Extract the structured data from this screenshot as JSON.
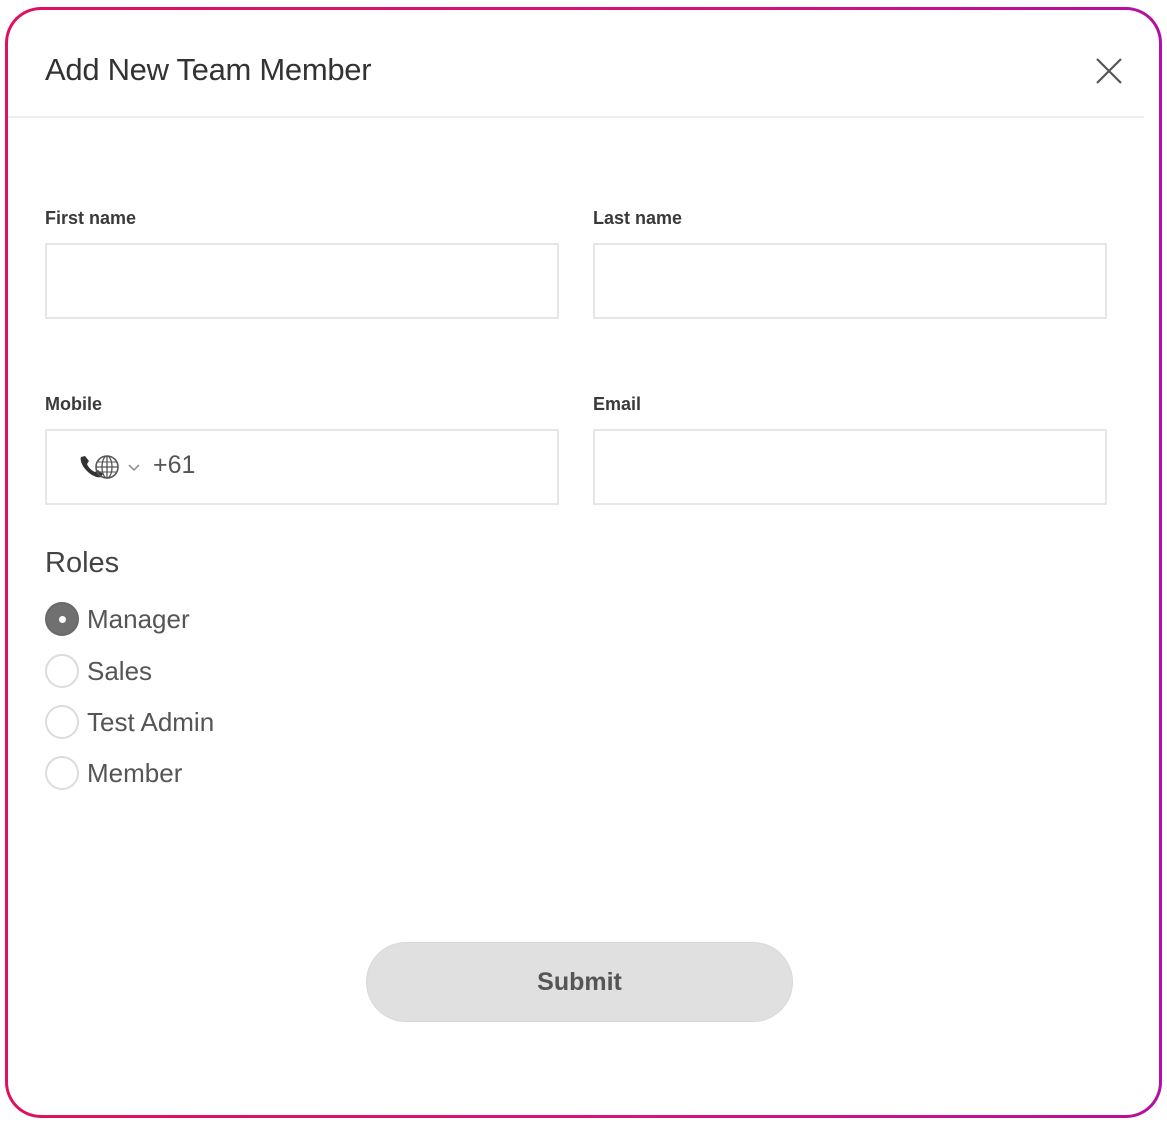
{
  "dialog": {
    "title": "Add New Team Member",
    "close_icon": "close-icon"
  },
  "form": {
    "first_name": {
      "label": "First name",
      "value": "",
      "placeholder": ""
    },
    "last_name": {
      "label": "Last name",
      "value": "",
      "placeholder": ""
    },
    "mobile": {
      "label": "Mobile",
      "icon": "phone-globe-icon",
      "dropdown_icon": "chevron-down-icon",
      "country_code": "+61",
      "value": ""
    },
    "email": {
      "label": "Email",
      "value": "",
      "placeholder": ""
    }
  },
  "roles": {
    "heading": "Roles",
    "selected": "Manager",
    "options": [
      {
        "label": "Manager",
        "checked": true
      },
      {
        "label": "Sales",
        "checked": false
      },
      {
        "label": "Test Admin",
        "checked": false
      },
      {
        "label": "Member",
        "checked": false
      }
    ]
  },
  "submit_label": "Submit",
  "colors": {
    "frame_gradient_start": "#e0105e",
    "frame_gradient_end": "#b4109f",
    "submit_bg": "#e0e0e0",
    "radio_checked": "#707070"
  }
}
